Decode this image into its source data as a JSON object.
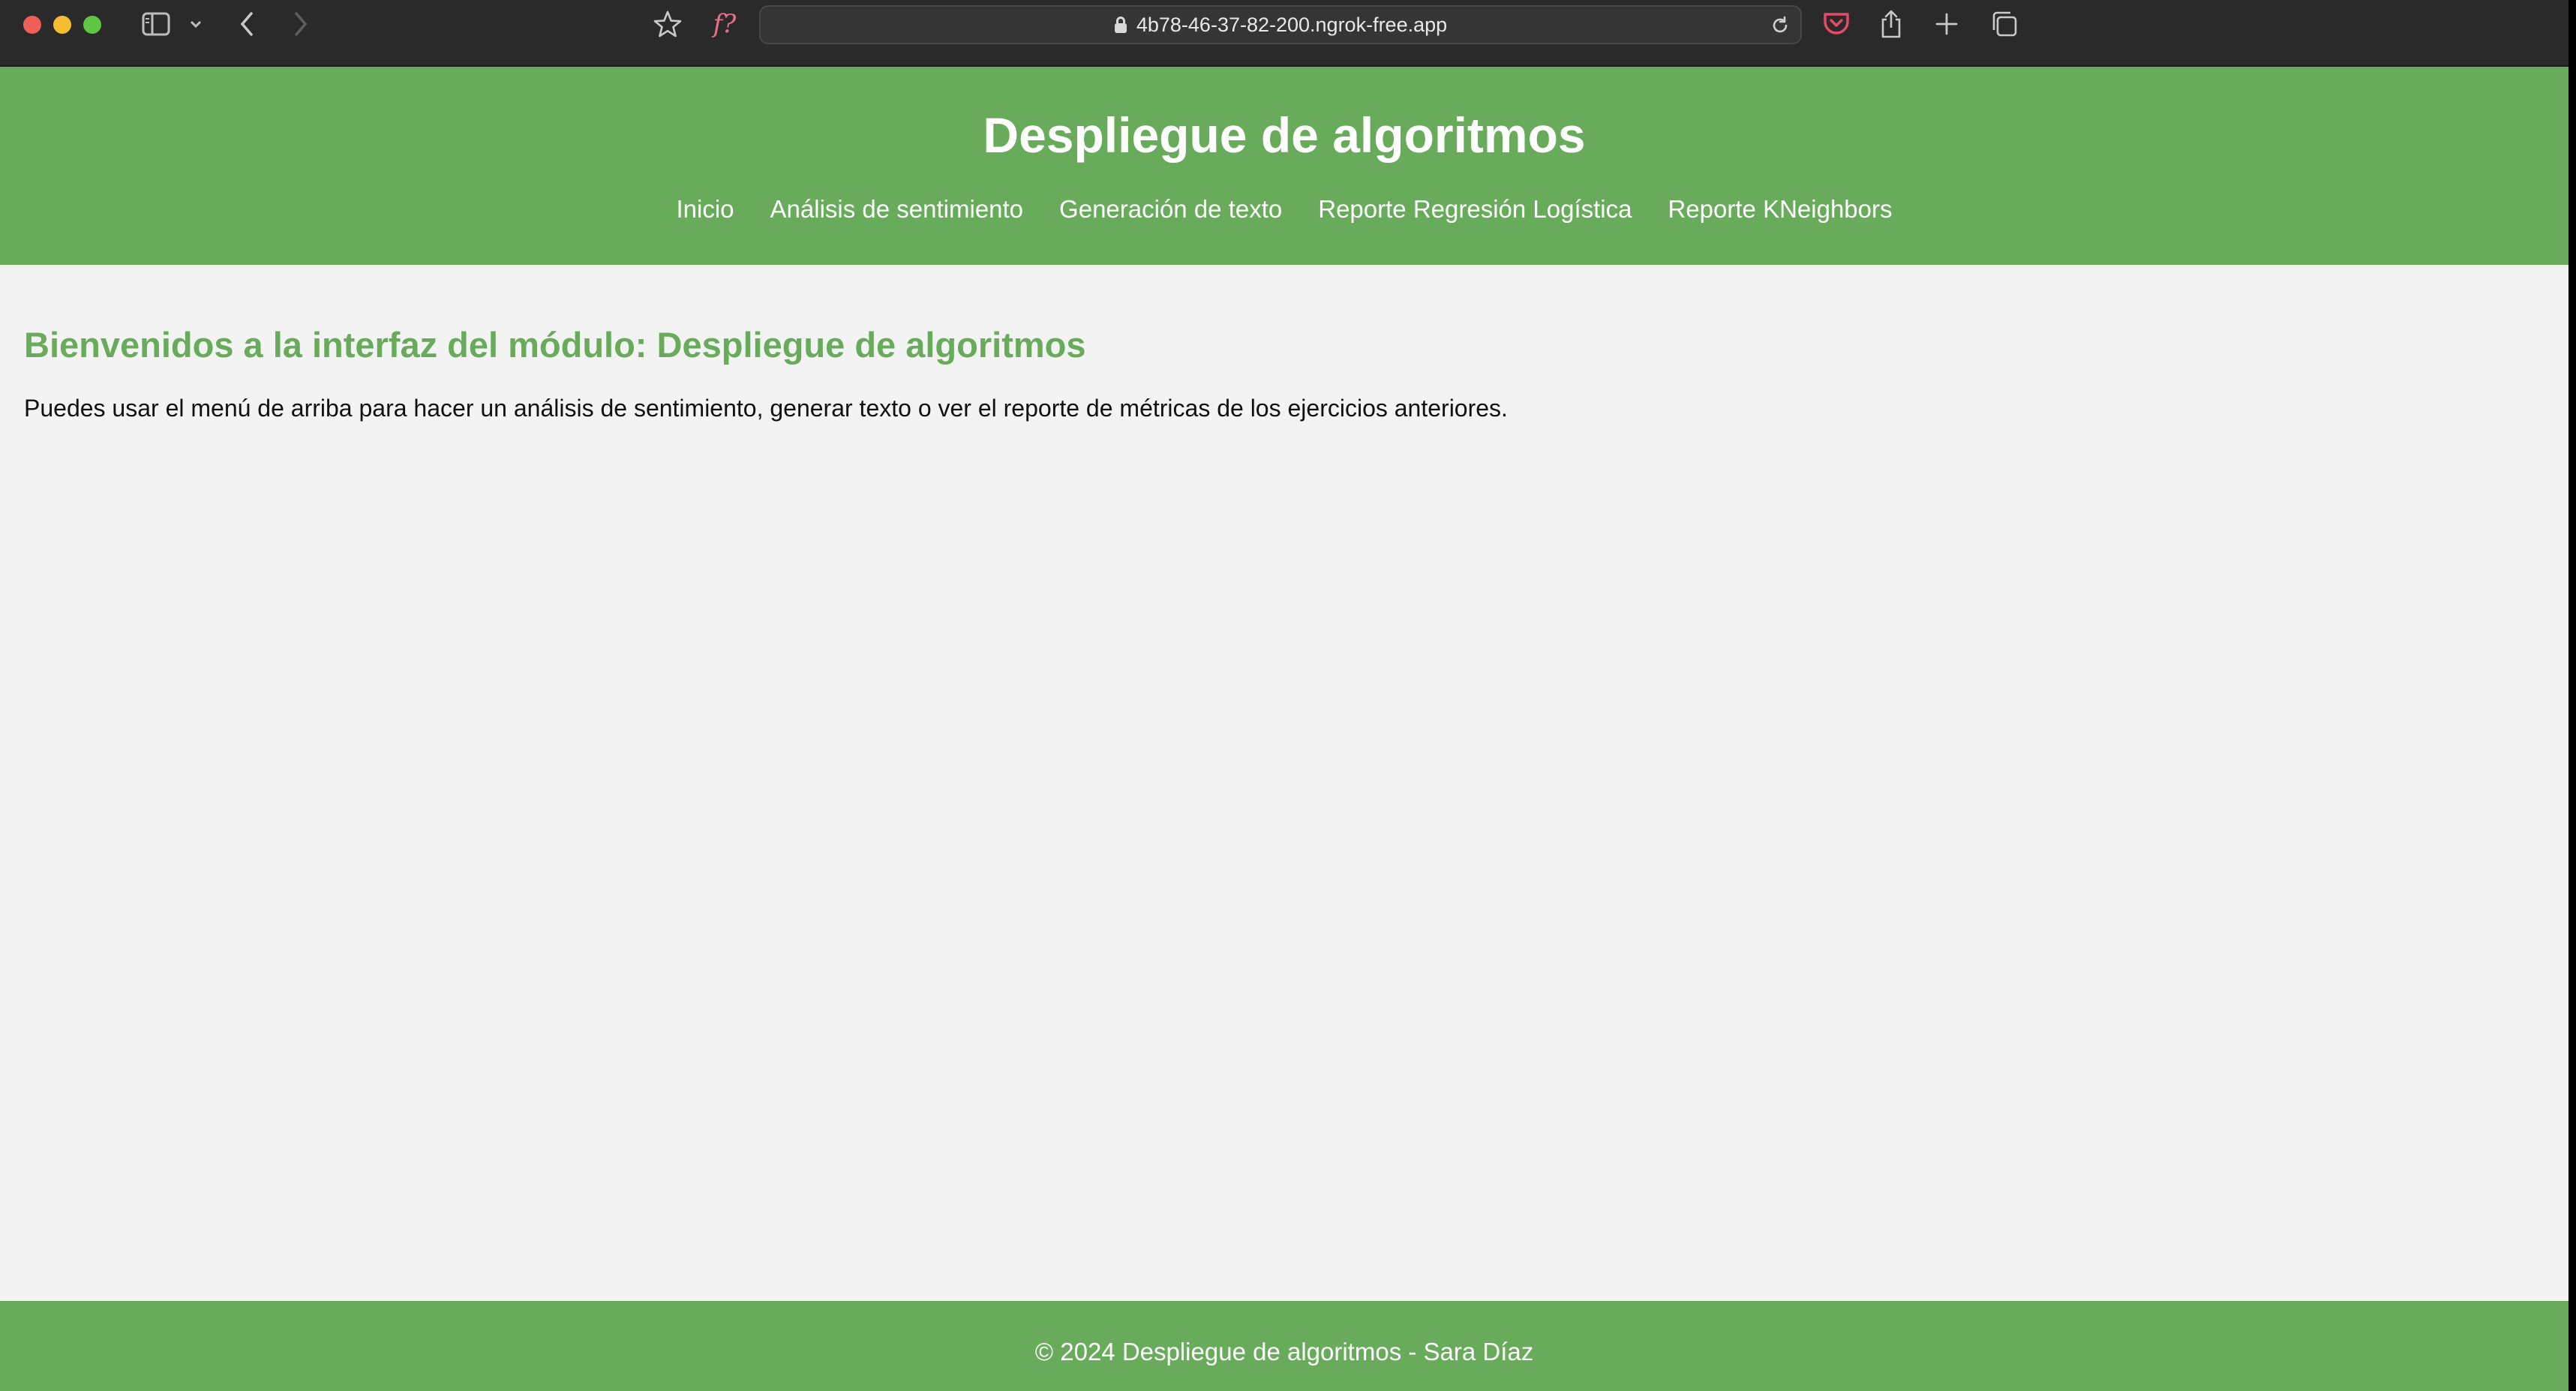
{
  "browser": {
    "url": "4b78-46-37-82-200.ngrok-free.app",
    "icons": [
      "sidebar-icon",
      "chevron-down-icon",
      "back-icon",
      "forward-icon",
      "star-icon",
      "font-icon",
      "lock-icon",
      "reload-icon",
      "pocket-icon",
      "share-icon",
      "new-tab-icon",
      "tabs-overview-icon"
    ],
    "font_icon_label": "f?"
  },
  "header": {
    "title": "Despliegue de algoritmos",
    "nav": [
      {
        "label": "Inicio"
      },
      {
        "label": "Análisis de sentimiento"
      },
      {
        "label": "Generación de texto"
      },
      {
        "label": "Reporte Regresión Logística"
      },
      {
        "label": "Reporte KNeighbors"
      }
    ]
  },
  "main": {
    "heading": "Bienvenidos a la interfaz del módulo: Despliegue de algoritmos",
    "paragraph": "Puedes usar el menú de arriba para hacer un análisis de sentimiento, generar texto o ver el reporte de métricas de los ejercicios anteriores."
  },
  "footer": {
    "text": "© 2024 Despliegue de algoritmos - Sara Díaz"
  },
  "colors": {
    "brand_green": "#68ac5b",
    "page_background": "#f4f3f4",
    "toolbar_background": "#2b2a2b"
  }
}
